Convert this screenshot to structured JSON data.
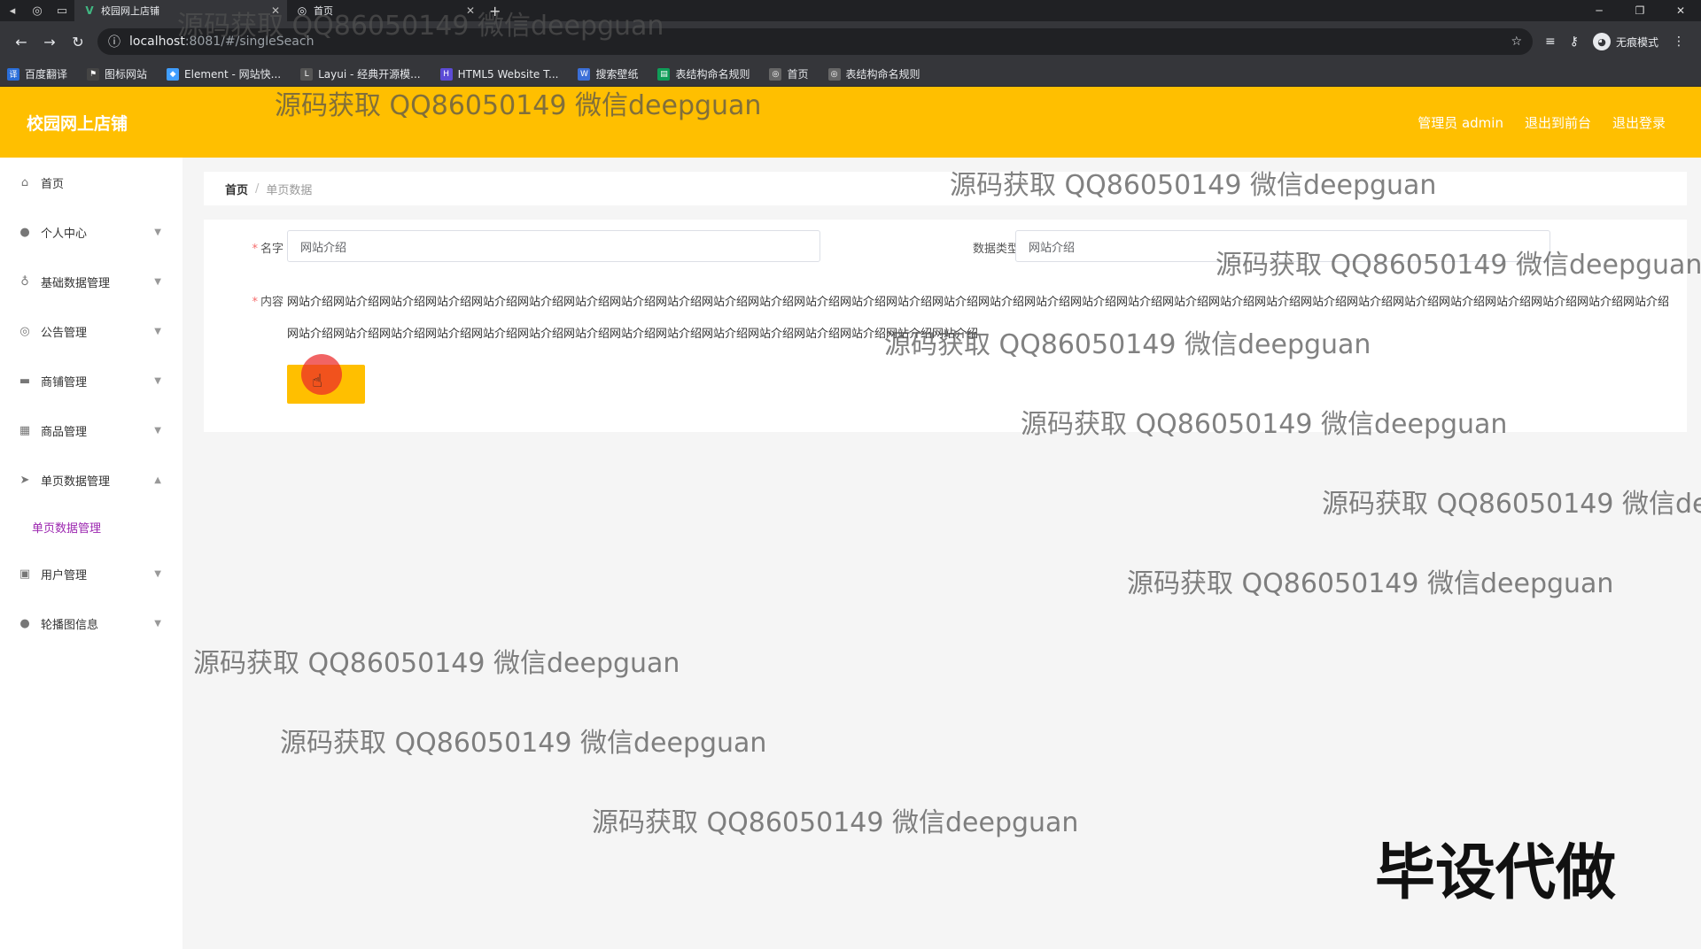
{
  "browser": {
    "tabs": [
      {
        "title": "校园网上店铺",
        "active": true
      },
      {
        "title": "首页",
        "active": false
      }
    ],
    "new_tab": "+",
    "url_host": "localhost",
    "url_path": ":8081/#/singleSeach",
    "incognito_label": "无痕模式",
    "bookmarks": [
      {
        "label": "百度翻译",
        "color": "#2a6ed9"
      },
      {
        "label": "图标网站",
        "color": "#444444"
      },
      {
        "label": "Element - 网站快...",
        "color": "#409eff"
      },
      {
        "label": "Layui - 经典开源模...",
        "color": "#555555"
      },
      {
        "label": "HTML5 Website T...",
        "color": "#5c4bd6"
      },
      {
        "label": "搜索壁纸",
        "color": "#3b6fd8"
      },
      {
        "label": "表结构命名规则",
        "color": "#0f9d58"
      },
      {
        "label": "首页",
        "color": "#666666"
      },
      {
        "label": "表结构命名规则",
        "color": "#666666"
      }
    ]
  },
  "app": {
    "logo": "校园网上店铺",
    "header_admin": "管理员 admin",
    "header_front": "退出到前台",
    "header_logout": "退出登录",
    "theme_color": "#ffbf00"
  },
  "sidebar": {
    "items": [
      {
        "label": "首页",
        "icon": "home-icon",
        "has_arrow": false
      },
      {
        "label": "个人中心",
        "icon": "user-icon",
        "has_arrow": true
      },
      {
        "label": "基础数据管理",
        "icon": "mic-icon",
        "has_arrow": true
      },
      {
        "label": "公告管理",
        "icon": "globe-icon",
        "has_arrow": true
      },
      {
        "label": "商铺管理",
        "icon": "chat-icon",
        "has_arrow": true
      },
      {
        "label": "商品管理",
        "icon": "grid-icon",
        "has_arrow": true
      },
      {
        "label": "单页数据管理",
        "icon": "send-icon",
        "has_arrow": true,
        "expanded": true
      }
    ],
    "subitem": "单页数据管理",
    "items_after": [
      {
        "label": "用户管理",
        "icon": "briefcase-icon",
        "has_arrow": true
      },
      {
        "label": "轮播图信息",
        "icon": "bulb-icon",
        "has_arrow": true
      }
    ]
  },
  "breadcrumb": {
    "home": "首页",
    "separator": "/",
    "current": "单页数据"
  },
  "form": {
    "name_label": "名字",
    "name_value": "网站介绍",
    "type_label": "数据类型",
    "type_value": "网站介绍",
    "content_label": "内容",
    "content_value": "网站介绍网站介绍网站介绍网站介绍网站介绍网站介绍网站介绍网站介绍网站介绍网站介绍网站介绍网站介绍网站介绍网站介绍网站介绍网站介绍网站介绍网站介绍网站介绍网站介绍网站介绍网站介绍网站介绍网站介绍网站介绍网站介绍网站介绍网站介绍网站介绍网站介绍网站介绍网站介绍网站介绍网站介绍网站介绍网站介绍网站介绍网站介绍网站介绍网站介绍网站介绍网站介绍网站介绍网站介绍网站介绍"
  },
  "watermark": {
    "text": "源码获取 QQ86050149 微信deepguan",
    "big": "毕设代做"
  }
}
